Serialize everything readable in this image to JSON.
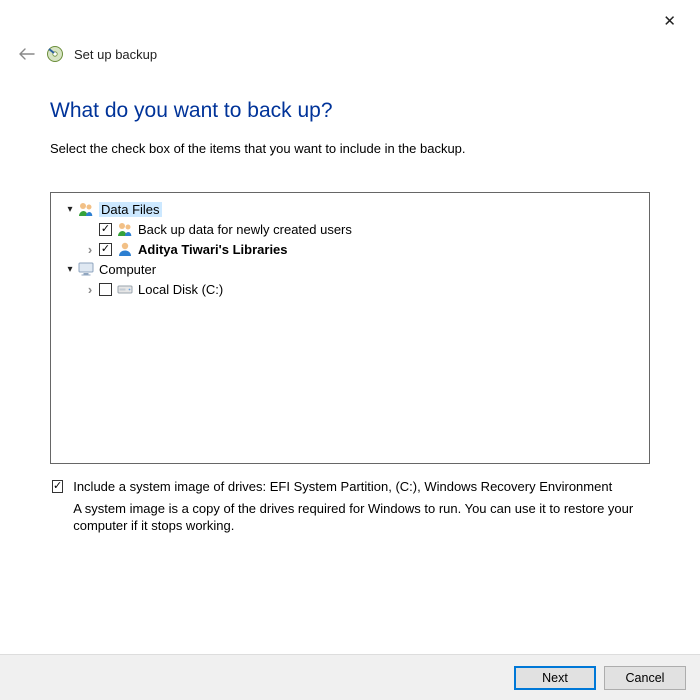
{
  "window": {
    "close_glyph": "✕"
  },
  "header": {
    "title": "Set up backup"
  },
  "main": {
    "heading": "What do you want to back up?",
    "subtitle": "Select the check box of the items that you want to include in the backup."
  },
  "tree": {
    "data_files": {
      "label": "Data Files",
      "newly_created": "Back up data for newly created users",
      "user_libraries": "Aditya Tiwari's Libraries"
    },
    "computer": {
      "label": "Computer",
      "local_disk": "Local Disk (C:)"
    }
  },
  "system_image": {
    "label": "Include a system image of drives: EFI System Partition, (C:), Windows Recovery Environment",
    "description": "A system image is a copy of the drives required for Windows to run. You can use it to restore your computer if it stops working."
  },
  "footer": {
    "next": "Next",
    "cancel": "Cancel"
  }
}
